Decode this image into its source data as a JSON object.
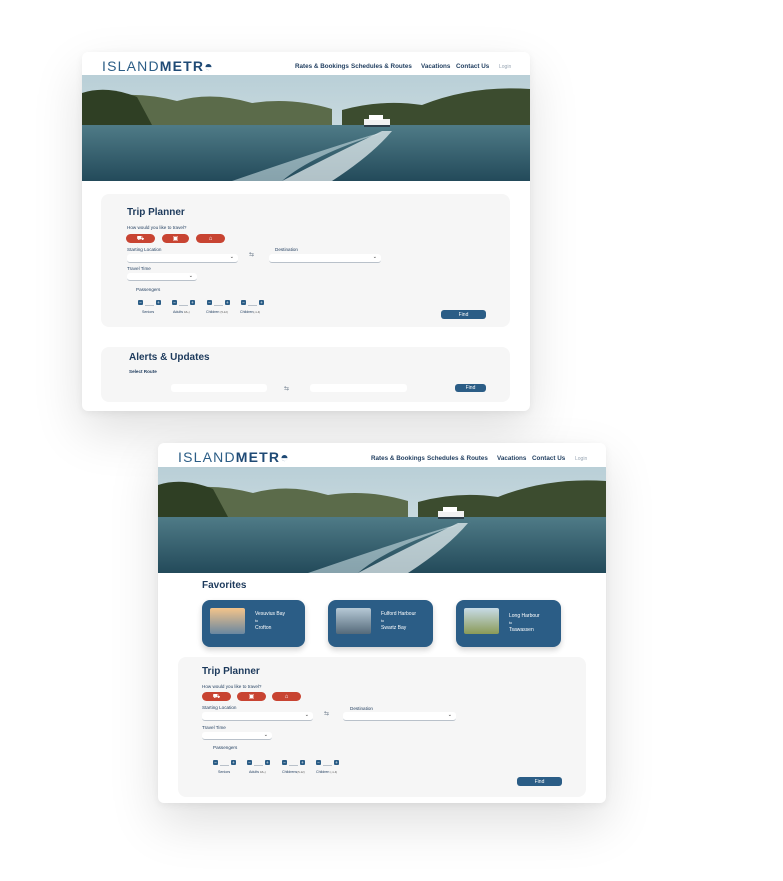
{
  "brand": {
    "logo_thin": "ISLAND",
    "logo_bold": "METR"
  },
  "nav": {
    "rates": "Rates & Bookings",
    "schedules": "Schedules & Routes",
    "vacations": "Vacations",
    "contact": "Contact Us",
    "login": "Login"
  },
  "trip_planner": {
    "title": "Trip Planner",
    "question": "How would you like to travel?",
    "modes": [
      "car-icon",
      "bus-icon",
      "bike-icon"
    ],
    "starting_label": "Starting Location",
    "destination_label": "Destination",
    "travel_time_label": "Travel Time",
    "passengers_label": "Passengers",
    "passengers": [
      {
        "label": "Seniors",
        "sub": ""
      },
      {
        "label": "Adults",
        "sub": "18+)"
      },
      {
        "label": "Children",
        "sub": "(5-12)"
      },
      {
        "label": "Children",
        "sub": "(-1-4)"
      }
    ],
    "passengers_bottom": [
      {
        "label": "Seniors",
        "sub": ""
      },
      {
        "label": "Adults",
        "sub": "18+)"
      },
      {
        "label": "Childrens",
        "sub": "(5-12)"
      },
      {
        "label": "Children",
        "sub": "(-1-4)"
      }
    ],
    "find": "Find"
  },
  "alerts": {
    "title": "Alerts & Updates",
    "select_route": "Select Route",
    "find": "Find"
  },
  "favorites": {
    "title": "Favorites",
    "connector": "to",
    "items": [
      {
        "from": "Vesuvius Bay",
        "to": "Crofton"
      },
      {
        "from": "Fulford Harbour",
        "to": "Swartz Bay"
      },
      {
        "from": "Long Harbour",
        "to": "Tsawassen"
      }
    ]
  },
  "colors": {
    "primary": "#2b5d86",
    "accent": "#c84432",
    "panel": "#f6f6f6"
  }
}
